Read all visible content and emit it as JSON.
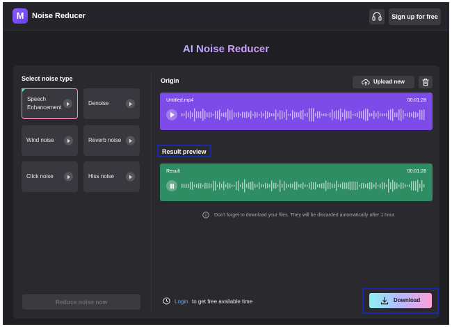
{
  "header": {
    "logo_letter": "M",
    "app_name": "Noise Reducer",
    "signup_label": "Sign up for free"
  },
  "main_title": "AI Noise Reducer",
  "noise_panel": {
    "title": "Select noise type",
    "types": [
      {
        "label": "Speech Enhancement",
        "selected": true
      },
      {
        "label": "Denoise",
        "selected": false
      },
      {
        "label": "Wind noise",
        "selected": false
      },
      {
        "label": "Reverb noise",
        "selected": false
      },
      {
        "label": "Click noise",
        "selected": false
      },
      {
        "label": "Hiss noise",
        "selected": false
      }
    ],
    "reduce_label": "Reduce noise now"
  },
  "origin": {
    "title": "Origin",
    "upload_label": "Upload new",
    "file_name": "Untitled.mp4",
    "duration": "00:01:28"
  },
  "result": {
    "title": "Result preview",
    "label": "Result",
    "duration": "00:01:28"
  },
  "notice": "Don't forget to download your files. They will be discarded automatically after 1 hour.",
  "login": {
    "link": "Login",
    "text": "to get free available time"
  },
  "download_label": "Download",
  "colors": {
    "origin_track": "#7d4be7",
    "result_track": "#2f8d64",
    "accent_link": "#5fb3ff"
  }
}
